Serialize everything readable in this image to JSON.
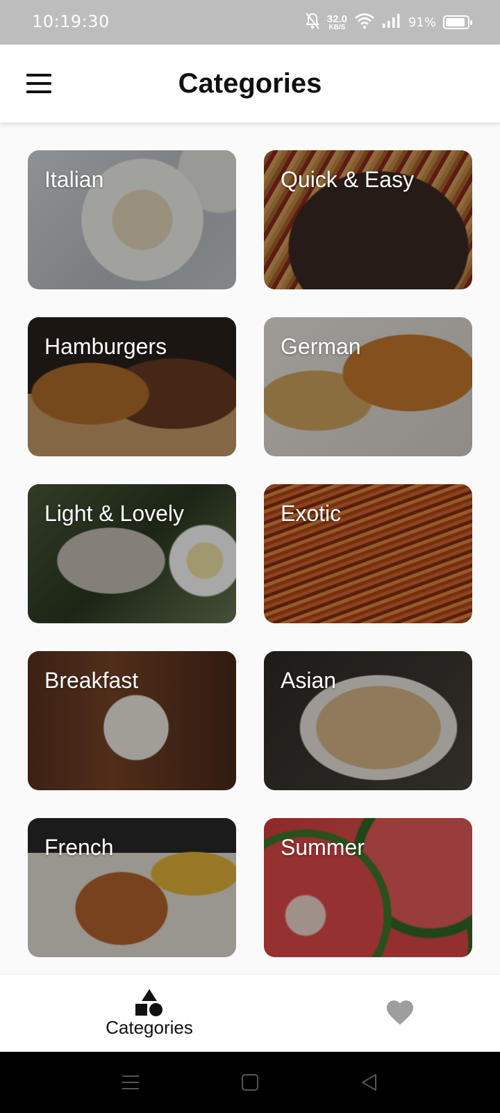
{
  "status_bar": {
    "time": "10:19:30",
    "speed_value": "32.0",
    "speed_unit": "KB/S",
    "battery_percent": "91%",
    "battery_level": 0.91,
    "icons": [
      "bell-muted-icon",
      "wifi-icon",
      "signal-icon",
      "battery-icon"
    ]
  },
  "app_bar": {
    "title": "Categories",
    "menu_icon": "hamburger-menu-icon"
  },
  "categories": [
    {
      "label": "Italian",
      "image": "pasta with seafood"
    },
    {
      "label": "Quick & Easy",
      "image": "spaghetti in pan"
    },
    {
      "label": "Hamburgers",
      "image": "burgers on board"
    },
    {
      "label": "German",
      "image": "schnitzel with potatoes"
    },
    {
      "label": "Light & Lovely",
      "image": "grilled fish salad"
    },
    {
      "label": "Exotic",
      "image": "noodles"
    },
    {
      "label": "Breakfast",
      "image": "english breakfast"
    },
    {
      "label": "Asian",
      "image": "noodles with chopsticks"
    },
    {
      "label": "French",
      "image": "duck with fries"
    },
    {
      "label": "Summer",
      "image": "watermelon slices"
    }
  ],
  "bottom_nav": {
    "categories_label": "Categories",
    "categories_icon": "shapes-icon",
    "favorites_icon": "heart-icon",
    "active": "categories",
    "inactive_color": "#9e9e9e"
  },
  "system_nav": {
    "icons": [
      "recents-icon",
      "home-icon",
      "back-icon"
    ]
  }
}
